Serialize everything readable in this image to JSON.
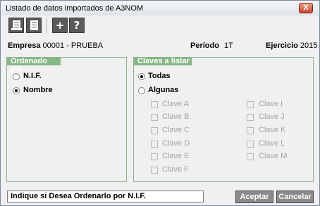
{
  "window": {
    "title": "Listado de datos importados de A3NOM",
    "close_label": "X"
  },
  "toolbar": {
    "plus_label": "+",
    "help_label": "?"
  },
  "info": {
    "empresa_label": "Empresa",
    "empresa_value": "00001 - PRUEBA",
    "periodo_label": "Período",
    "periodo_value": "1T",
    "ejercicio_label": "Ejercicio",
    "ejercicio_value": "2015"
  },
  "ordenado": {
    "title": "Ordenado por",
    "options": [
      {
        "label": "N.I.F.",
        "selected": false
      },
      {
        "label": "Nombre",
        "selected": true
      }
    ]
  },
  "claves": {
    "title": "Claves a listar",
    "options": [
      {
        "label": "Todas",
        "selected": true
      },
      {
        "label": "Algunas",
        "selected": false
      }
    ],
    "items": [
      "Clave A",
      "Clave B",
      "Clave C",
      "Clave D",
      "Clave E",
      "Clave F",
      "Clave I",
      "Clave J",
      "Clave K",
      "Clave L",
      "Clave M"
    ]
  },
  "status": {
    "text": "Indique si Desea Ordenarlo por N.I.F."
  },
  "buttons": {
    "accept": "Aceptar",
    "cancel": "Cancelar"
  }
}
